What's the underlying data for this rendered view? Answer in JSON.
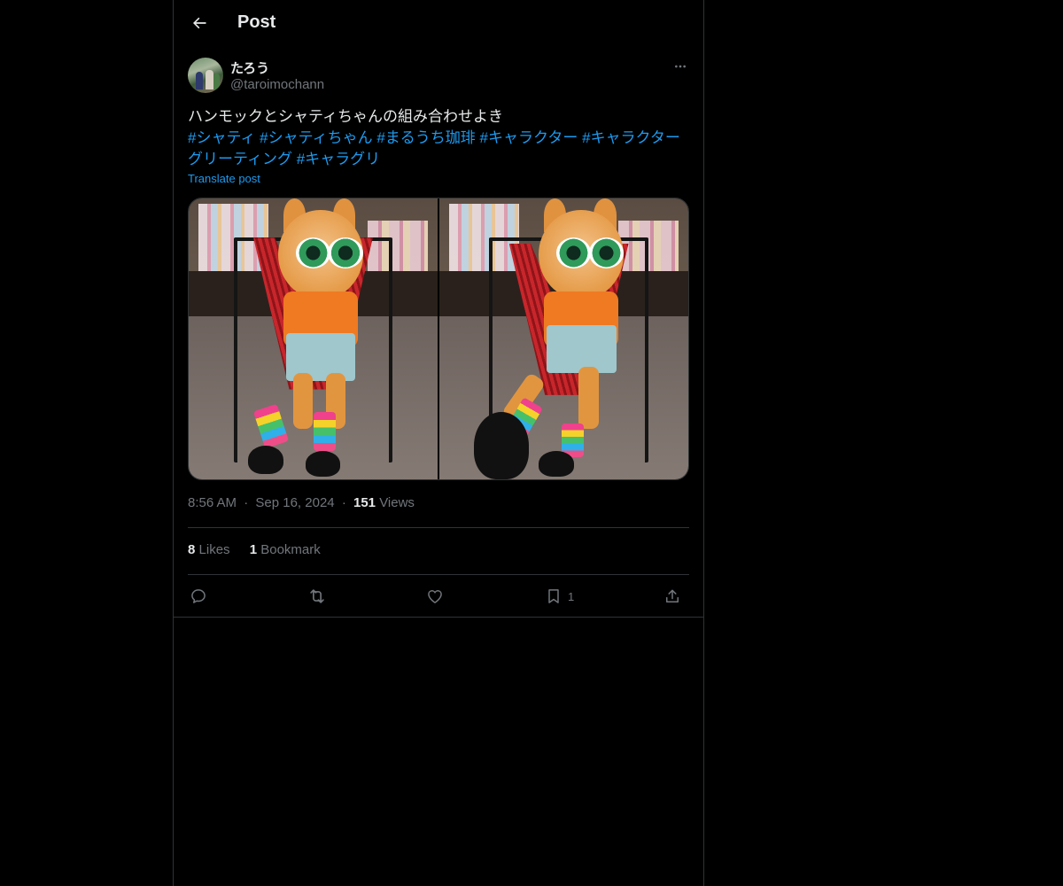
{
  "header": {
    "title": "Post"
  },
  "author": {
    "display_name": "たろう",
    "handle": "@taroimochann"
  },
  "post": {
    "text": "ハンモックとシャティちゃんの組み合わせよき",
    "hashtags": [
      "#シャティ",
      "#シャティちゃん",
      "#まるうち珈琲",
      "#キャラクター",
      "#キャラクターグリーティング",
      "#キャラグリ"
    ],
    "translate_label": "Translate post"
  },
  "meta": {
    "time": "8:56 AM",
    "separator": "·",
    "date": "Sep 16, 2024",
    "views_count": "151",
    "views_label": "Views"
  },
  "stats": {
    "likes_count": "8",
    "likes_label": "Likes",
    "bookmarks_count": "1",
    "bookmarks_label": "Bookmark"
  },
  "actions": {
    "bookmark_count": "1"
  },
  "icons": {
    "back": "arrow-left-icon",
    "more": "more-horizontal-icon",
    "reply": "reply-icon",
    "repost": "repost-icon",
    "like": "heart-icon",
    "bookmark": "bookmark-icon",
    "share": "share-icon"
  },
  "colors": {
    "background": "#000000",
    "text": "#e7e9ea",
    "secondary": "#71767b",
    "accent": "#1d9bf0",
    "border": "#2f3336"
  }
}
